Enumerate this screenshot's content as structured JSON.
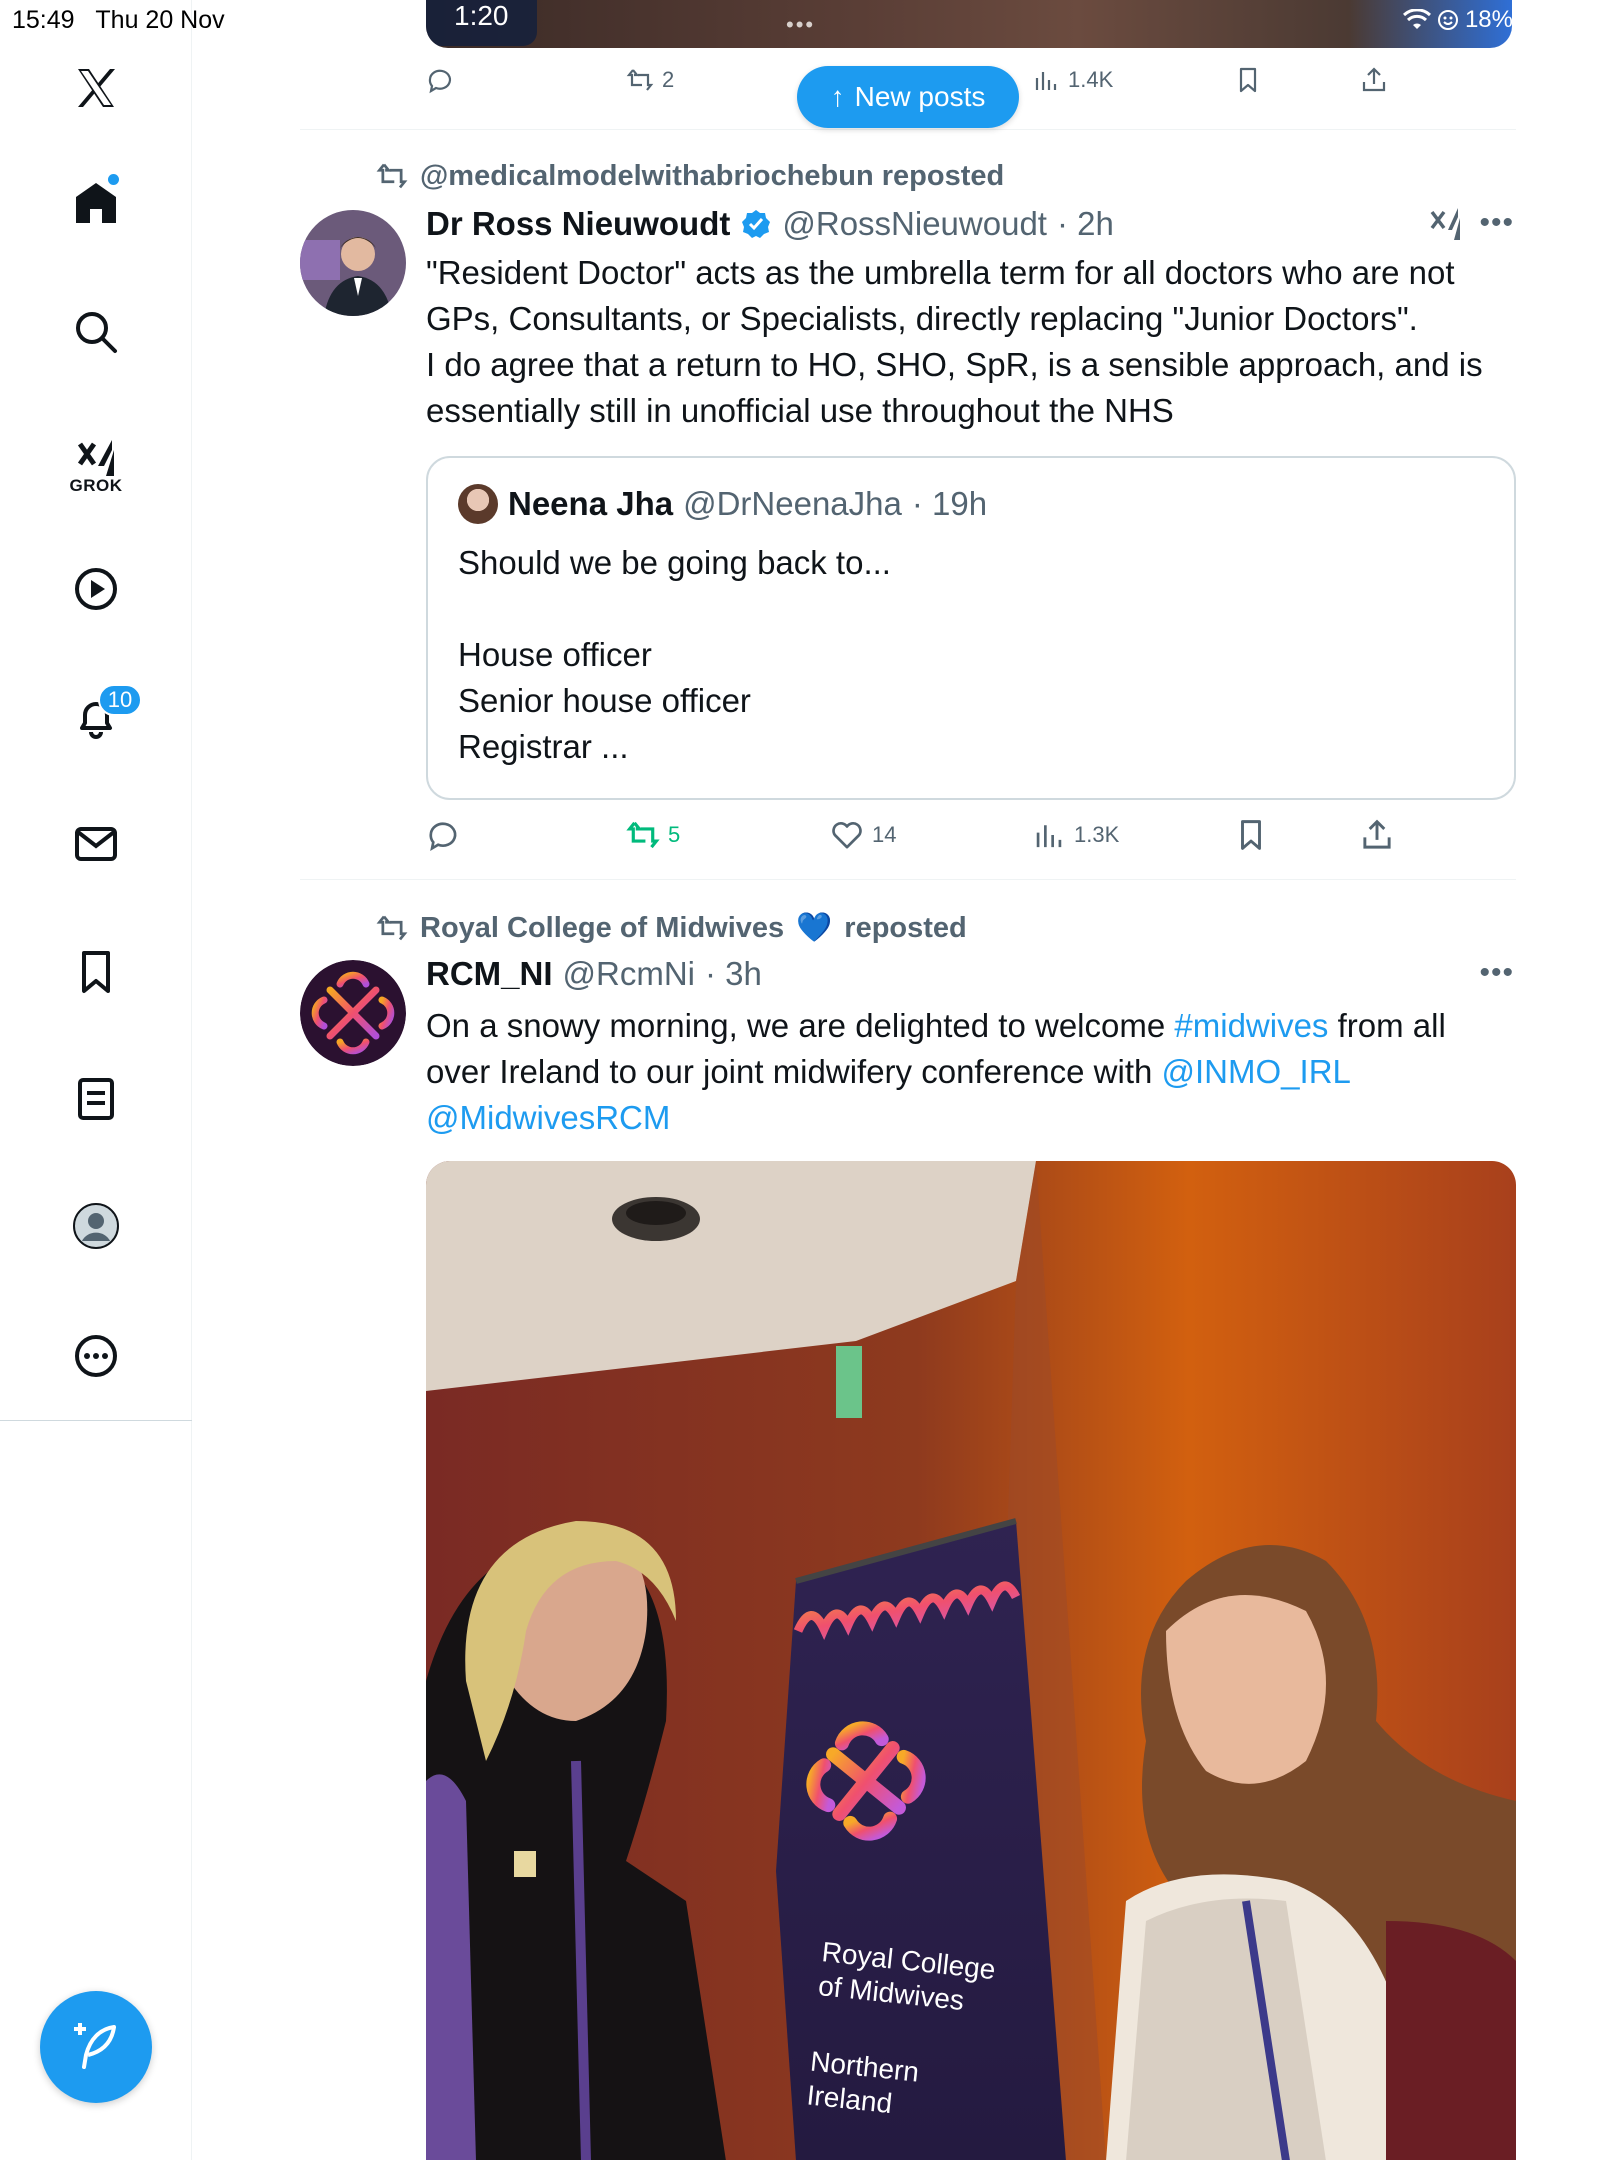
{
  "status_bar": {
    "time": "15:49",
    "date": "Thu 20 Nov",
    "battery": "18%"
  },
  "sidebar": {
    "grok_label": "GROK",
    "notifications_badge": "10"
  },
  "top_post": {
    "video_time": "1:20",
    "actions": {
      "reposts": "2",
      "views": "1.4K"
    }
  },
  "new_posts_label": "New posts",
  "post1": {
    "repost_by": "@medicalmodelwithabriochebun reposted",
    "author_name": "Dr Ross Nieuwoudt",
    "handle": "@RossNieuwoudt",
    "time": "· 2h",
    "text": "\"Resident Doctor\" acts as the umbrella term for all doctors who are not GPs, Consultants, or Specialists, directly replacing \"Junior Doctors\".\nI do agree that a return to HO, SHO, SpR, is a sensible approach, and is essentially still in unofficial use throughout the NHS",
    "quote": {
      "author_name": "Neena Jha",
      "handle": "@DrNeenaJha",
      "time": "· 19h",
      "text": "Should we be going back to...\n\nHouse officer\nSenior house officer\nRegistrar ..."
    },
    "actions": {
      "reposts": "5",
      "likes": "14",
      "views": "1.3K"
    }
  },
  "post2": {
    "repost_by_name": "Royal College of Midwives",
    "repost_by_emoji": "💙",
    "repost_suffix": "reposted",
    "author_name": "RCM_NI",
    "handle": "@RcmNi",
    "time": "· 3h",
    "text_before": "On a snowy morning, we are delighted to welcome ",
    "hashtag": "#midwives",
    "text_middle": " from all over Ireland to our joint midwifery conference with ",
    "mention1": "@INMO_IRL",
    "mention2": "@MidwivesRCM",
    "banner_text_1": "Royal College",
    "banner_text_2": "of Midwives",
    "banner_text_3": "Northern",
    "banner_text_4": "Ireland"
  },
  "colors": {
    "accent": "#1d9bf0",
    "repost_green": "#00ba7c",
    "muted": "#536471"
  }
}
